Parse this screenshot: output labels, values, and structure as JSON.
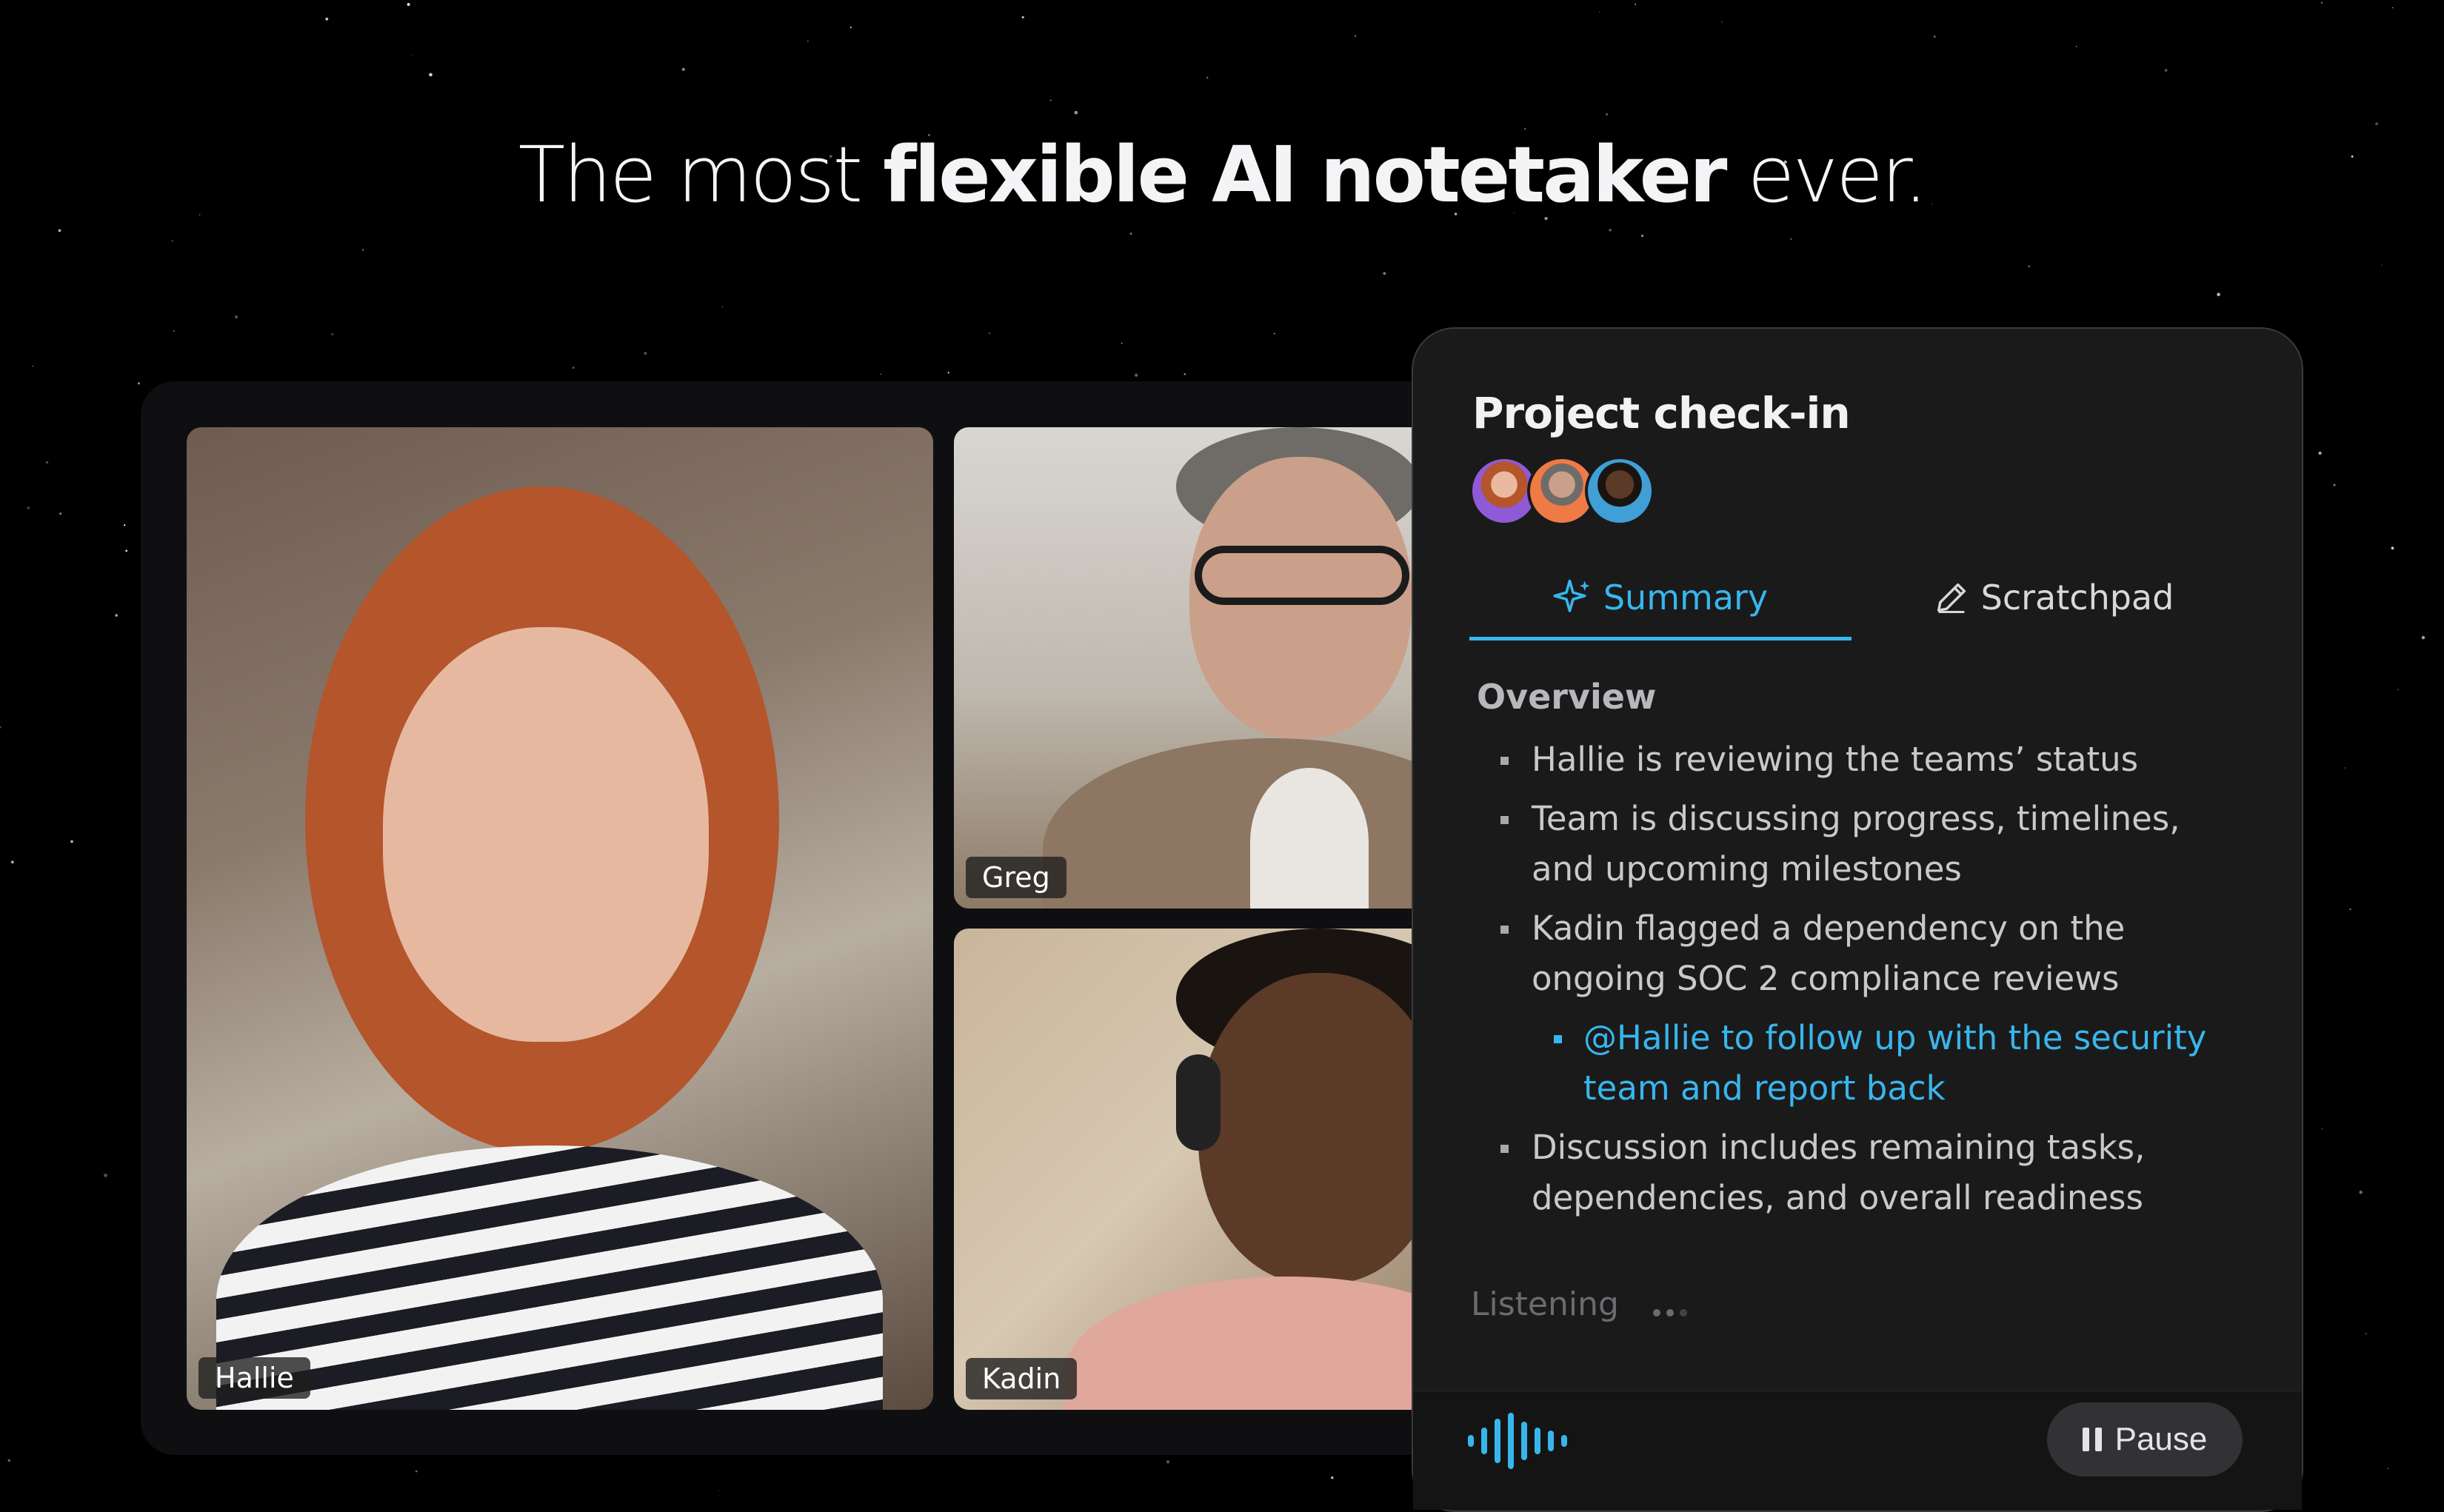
{
  "headline": {
    "prefix": "The most",
    "bold": "flexible AI notetaker",
    "suffix": "ever."
  },
  "participants": [
    {
      "name": "Hallie"
    },
    {
      "name": "Greg"
    },
    {
      "name": "Kadin"
    }
  ],
  "notes": {
    "title": "Project check-in",
    "tabs": [
      {
        "label": "Summary",
        "icon": "sparkle-icon",
        "active": true
      },
      {
        "label": "Scratchpad",
        "icon": "pencil-icon",
        "active": false
      }
    ],
    "section_title": "Overview",
    "items": [
      {
        "text": "Hallie is reviewing the teams’ status",
        "level": 1
      },
      {
        "text": "Team is discussing progress, timelines, and upcoming milestones",
        "level": 1
      },
      {
        "text": "Kadin flagged a dependency on the ongoing SOC 2 compliance reviews",
        "level": 1
      },
      {
        "text": "@Hallie to follow up with the security team and report back",
        "level": 2
      },
      {
        "text": "Discussion includes remaining tasks, dependencies, and overall readiness",
        "level": 1
      }
    ],
    "status": "Listening",
    "pause_label": "Pause"
  },
  "colors": {
    "accent": "#38b6ec",
    "background": "#000000",
    "card": "#1a1a1b"
  }
}
